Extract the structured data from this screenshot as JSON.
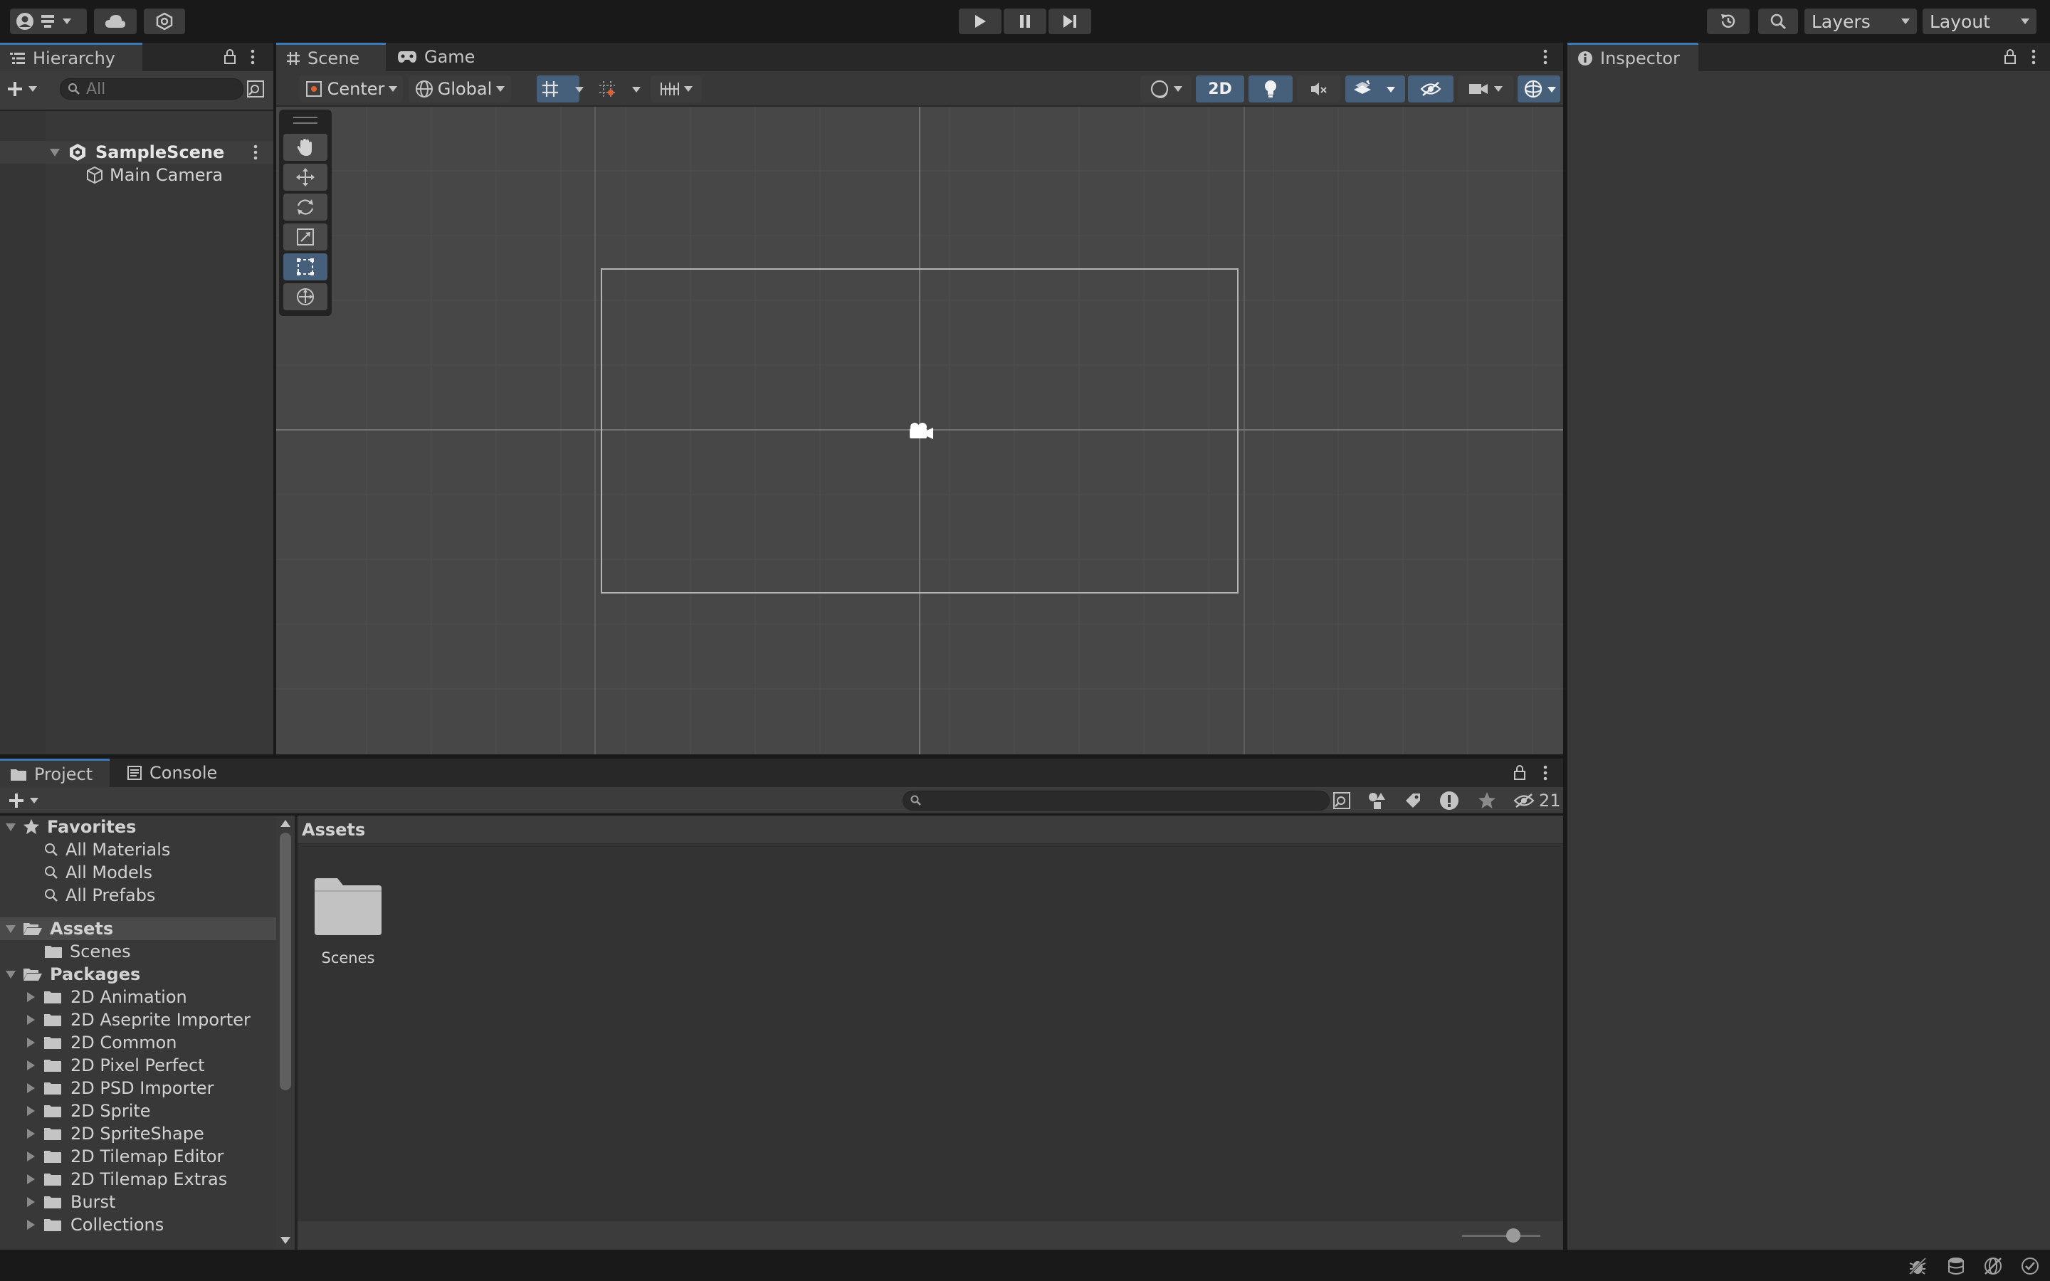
{
  "toolbar": {
    "layers_label": "Layers",
    "layout_label": "Layout"
  },
  "hierarchy": {
    "tab_label": "Hierarchy",
    "search_placeholder": "All",
    "scene_name": "SampleScene",
    "objects": [
      "Main Camera"
    ]
  },
  "scene_view": {
    "tabs": [
      {
        "label": "Scene"
      },
      {
        "label": "Game"
      }
    ],
    "pivot_label": "Center",
    "space_label": "Global",
    "mode_2d_label": "2D"
  },
  "inspector": {
    "tab_label": "Inspector"
  },
  "project": {
    "tabs": [
      {
        "label": "Project"
      },
      {
        "label": "Console"
      }
    ],
    "hidden_count": "21",
    "breadcrumb": "Assets",
    "favorites": {
      "label": "Favorites",
      "items": [
        "All Materials",
        "All Models",
        "All Prefabs"
      ]
    },
    "assets": {
      "label": "Assets",
      "children": [
        "Scenes"
      ]
    },
    "packages": {
      "label": "Packages",
      "children": [
        "2D Animation",
        "2D Aseprite Importer",
        "2D Common",
        "2D Pixel Perfect",
        "2D PSD Importer",
        "2D Sprite",
        "2D SpriteShape",
        "2D Tilemap Editor",
        "2D Tilemap Extras",
        "Burst",
        "Collections"
      ]
    },
    "grid_items": [
      {
        "label": "Scenes",
        "icon": "folder-icon"
      }
    ]
  },
  "colors": {
    "accent_active": "#46607c",
    "tab_highlight": "#3a79bb",
    "panel": "#383838",
    "scene_bg": "#474747"
  }
}
